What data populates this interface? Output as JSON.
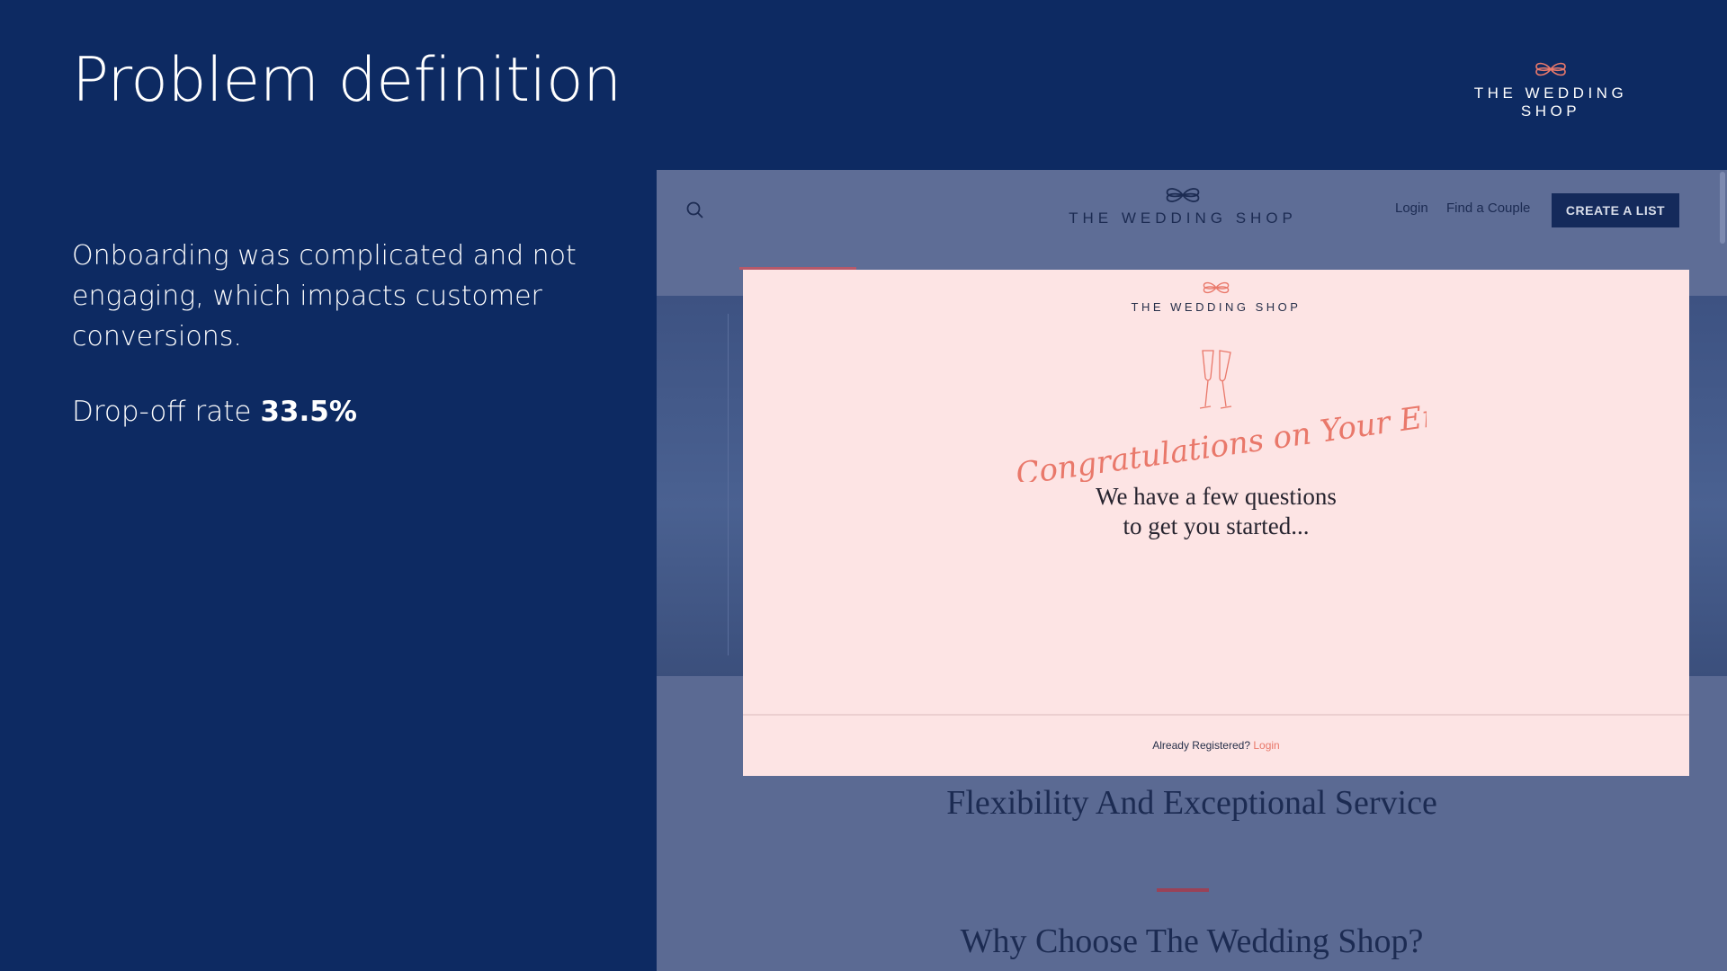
{
  "slide": {
    "title": "Problem definition",
    "brand": "THE WEDDING SHOP",
    "description": "Onboarding was complicated and not engaging, which impacts customer conversions.",
    "dropoff_label": "Drop-off rate",
    "dropoff_value": "33.5%"
  },
  "site": {
    "brand": "THE WEDDING SHOP",
    "nav": {
      "login": "Login",
      "find_couple": "Find a Couple",
      "cta": "CREATE A LIST"
    },
    "tagline": "Flexibility And Exceptional Service",
    "subheading": "Why Choose The Wedding Shop?"
  },
  "modal": {
    "brand": "THE WEDDING SHOP",
    "script_heading": "Congratulations on Your Engagement!",
    "lead_line1": "We have a few questions",
    "lead_line2": "to get you started...",
    "footer_text": "Already Registered?",
    "footer_link": "Login"
  },
  "colors": {
    "slide_bg": "#0d2a62",
    "modal_bg": "#fde4e4",
    "accent": "#e9786a",
    "site_cta": "#142a5b"
  }
}
